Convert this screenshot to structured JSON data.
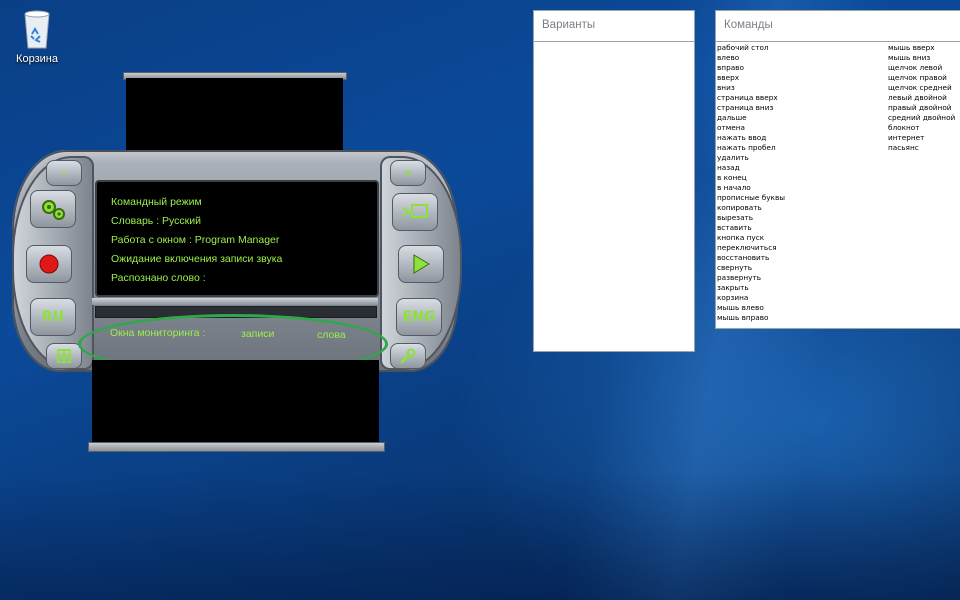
{
  "desktop": {
    "recycle_bin_label": "Корзина"
  },
  "player": {
    "buttons": {
      "minimize": "–",
      "close": "✕",
      "settings_icon": "gears-icon",
      "window_icon": "window-arrow-icon",
      "record_icon": "red-record-icon",
      "play_icon": "green-play-icon",
      "lang_ru": "RU",
      "lang_eng": "ENG",
      "grid_icon": "grid-icon",
      "wrench_icon": "wrench-icon"
    },
    "screen": {
      "line1": "Командный режим",
      "line2": "Словарь : Русский",
      "line3": "Работа с окном : Program Manager",
      "line4": "Ожидание включения записи звука",
      "line5": "Распознано слово :"
    },
    "monitor": {
      "label": "Окна мониторинга :",
      "records": "записи",
      "words": "слова"
    },
    "colors": {
      "screen_text": "#9cf04a",
      "highlight": "#2fa84a",
      "record": "#e01818"
    }
  },
  "variants_panel": {
    "title": "Варианты"
  },
  "commands_panel": {
    "title": "Команды",
    "column1": [
      "рабочий стол",
      "влево",
      "вправо",
      "вверх",
      "вниз",
      "страница вверх",
      "страница вниз",
      "дальше",
      "отмена",
      "нажать ввод",
      "нажать пробел",
      "удалить",
      "назад",
      "в конец",
      "в начало",
      "прописные буквы",
      "копировать",
      "вырезать",
      "вставить",
      "кнопка пуск",
      "переключиться",
      "восстановить",
      "свернуть",
      "развернуть",
      "закрыть",
      "корзина",
      "мышь влево",
      "мышь вправо"
    ],
    "column2": [
      "мышь вверх",
      "мышь вниз",
      "щелчок левой",
      "щелчок правой",
      "щелчок средней",
      "левый двойной",
      "правый двойной",
      "средний двойной",
      "блокнот",
      "интернет",
      "пасьянс"
    ]
  }
}
